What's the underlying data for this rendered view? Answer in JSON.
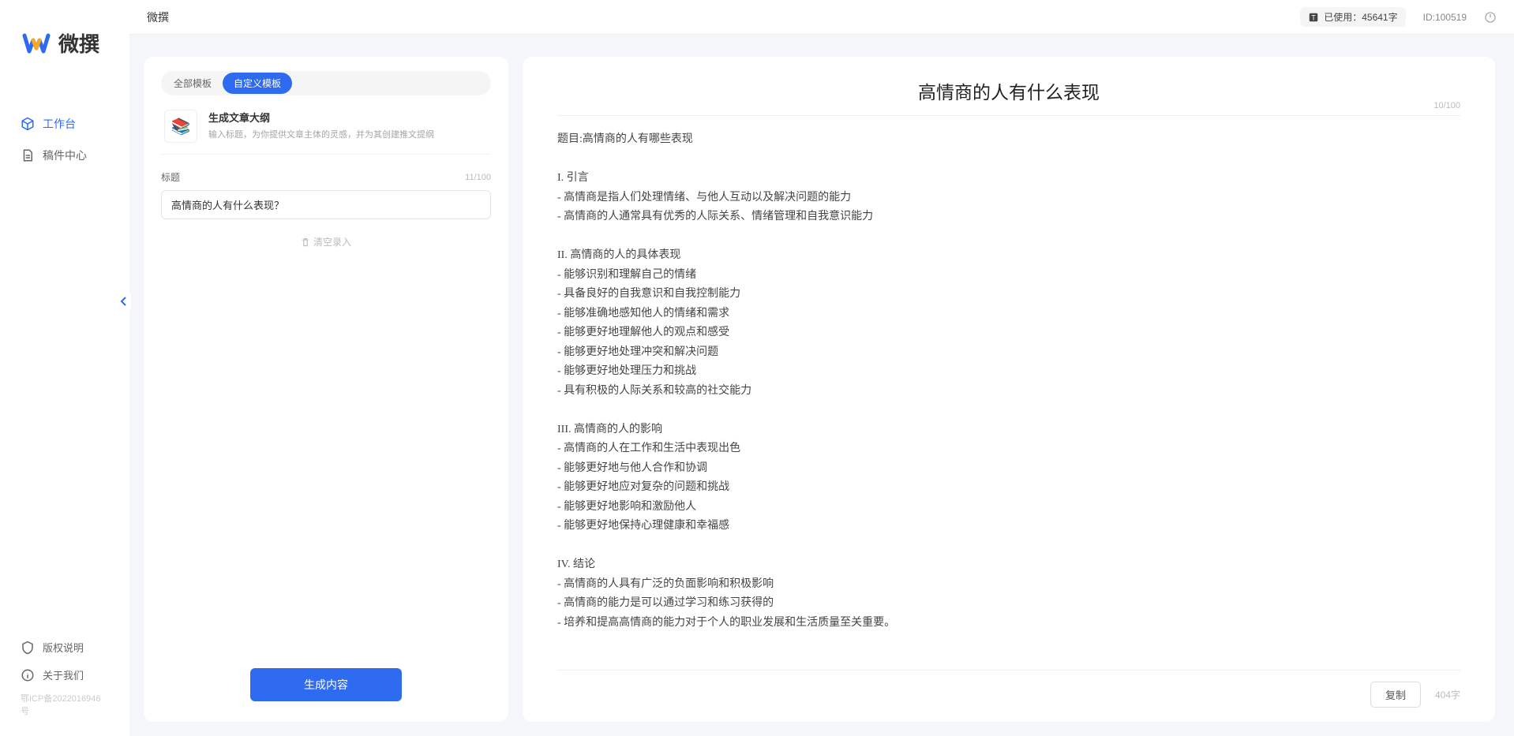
{
  "brand": {
    "name": "微撰"
  },
  "header": {
    "title": "微撰",
    "usage_label": "已使用：45641字",
    "user_id": "ID:100519"
  },
  "sidebar": {
    "items": [
      {
        "label": "工作台",
        "active": true
      },
      {
        "label": "稿件中心",
        "active": false
      }
    ],
    "bottom": [
      {
        "label": "版权说明"
      },
      {
        "label": "关于我们"
      }
    ],
    "icp": "鄂ICP备2022016946号"
  },
  "left_panel": {
    "tabs": [
      {
        "label": "全部模板",
        "active": false
      },
      {
        "label": "自定义模板",
        "active": true
      }
    ],
    "template": {
      "icon": "📚",
      "title": "生成文章大纲",
      "desc": "输入标题，为你提供文章主体的灵感，并为其创建推文提纲"
    },
    "field_label": "标题",
    "char_count": "11/100",
    "input_value": "高情商的人有什么表现？",
    "clear_label": "清空录入",
    "generate_label": "生成内容"
  },
  "output": {
    "title": "高情商的人有什么表现",
    "title_counter": "10/100",
    "body": "题目:高情商的人有哪些表现\n\nI. 引言\n- 高情商是指人们处理情绪、与他人互动以及解决问题的能力\n- 高情商的人通常具有优秀的人际关系、情绪管理和自我意识能力\n\nII. 高情商的人的具体表现\n- 能够识别和理解自己的情绪\n- 具备良好的自我意识和自我控制能力\n- 能够准确地感知他人的情绪和需求\n- 能够更好地理解他人的观点和感受\n- 能够更好地处理冲突和解决问题\n- 能够更好地处理压力和挑战\n- 具有积极的人际关系和较高的社交能力\n\nIII. 高情商的人的影响\n- 高情商的人在工作和生活中表现出色\n- 能够更好地与他人合作和协调\n- 能够更好地应对复杂的问题和挑战\n- 能够更好地影响和激励他人\n- 能够更好地保持心理健康和幸福感\n\nIV. 结论\n- 高情商的人具有广泛的负面影响和积极影响\n- 高情商的能力是可以通过学习和练习获得的\n- 培养和提高高情商的能力对于个人的职业发展和生活质量至关重要。",
    "copy_label": "复制",
    "word_count": "404字"
  }
}
